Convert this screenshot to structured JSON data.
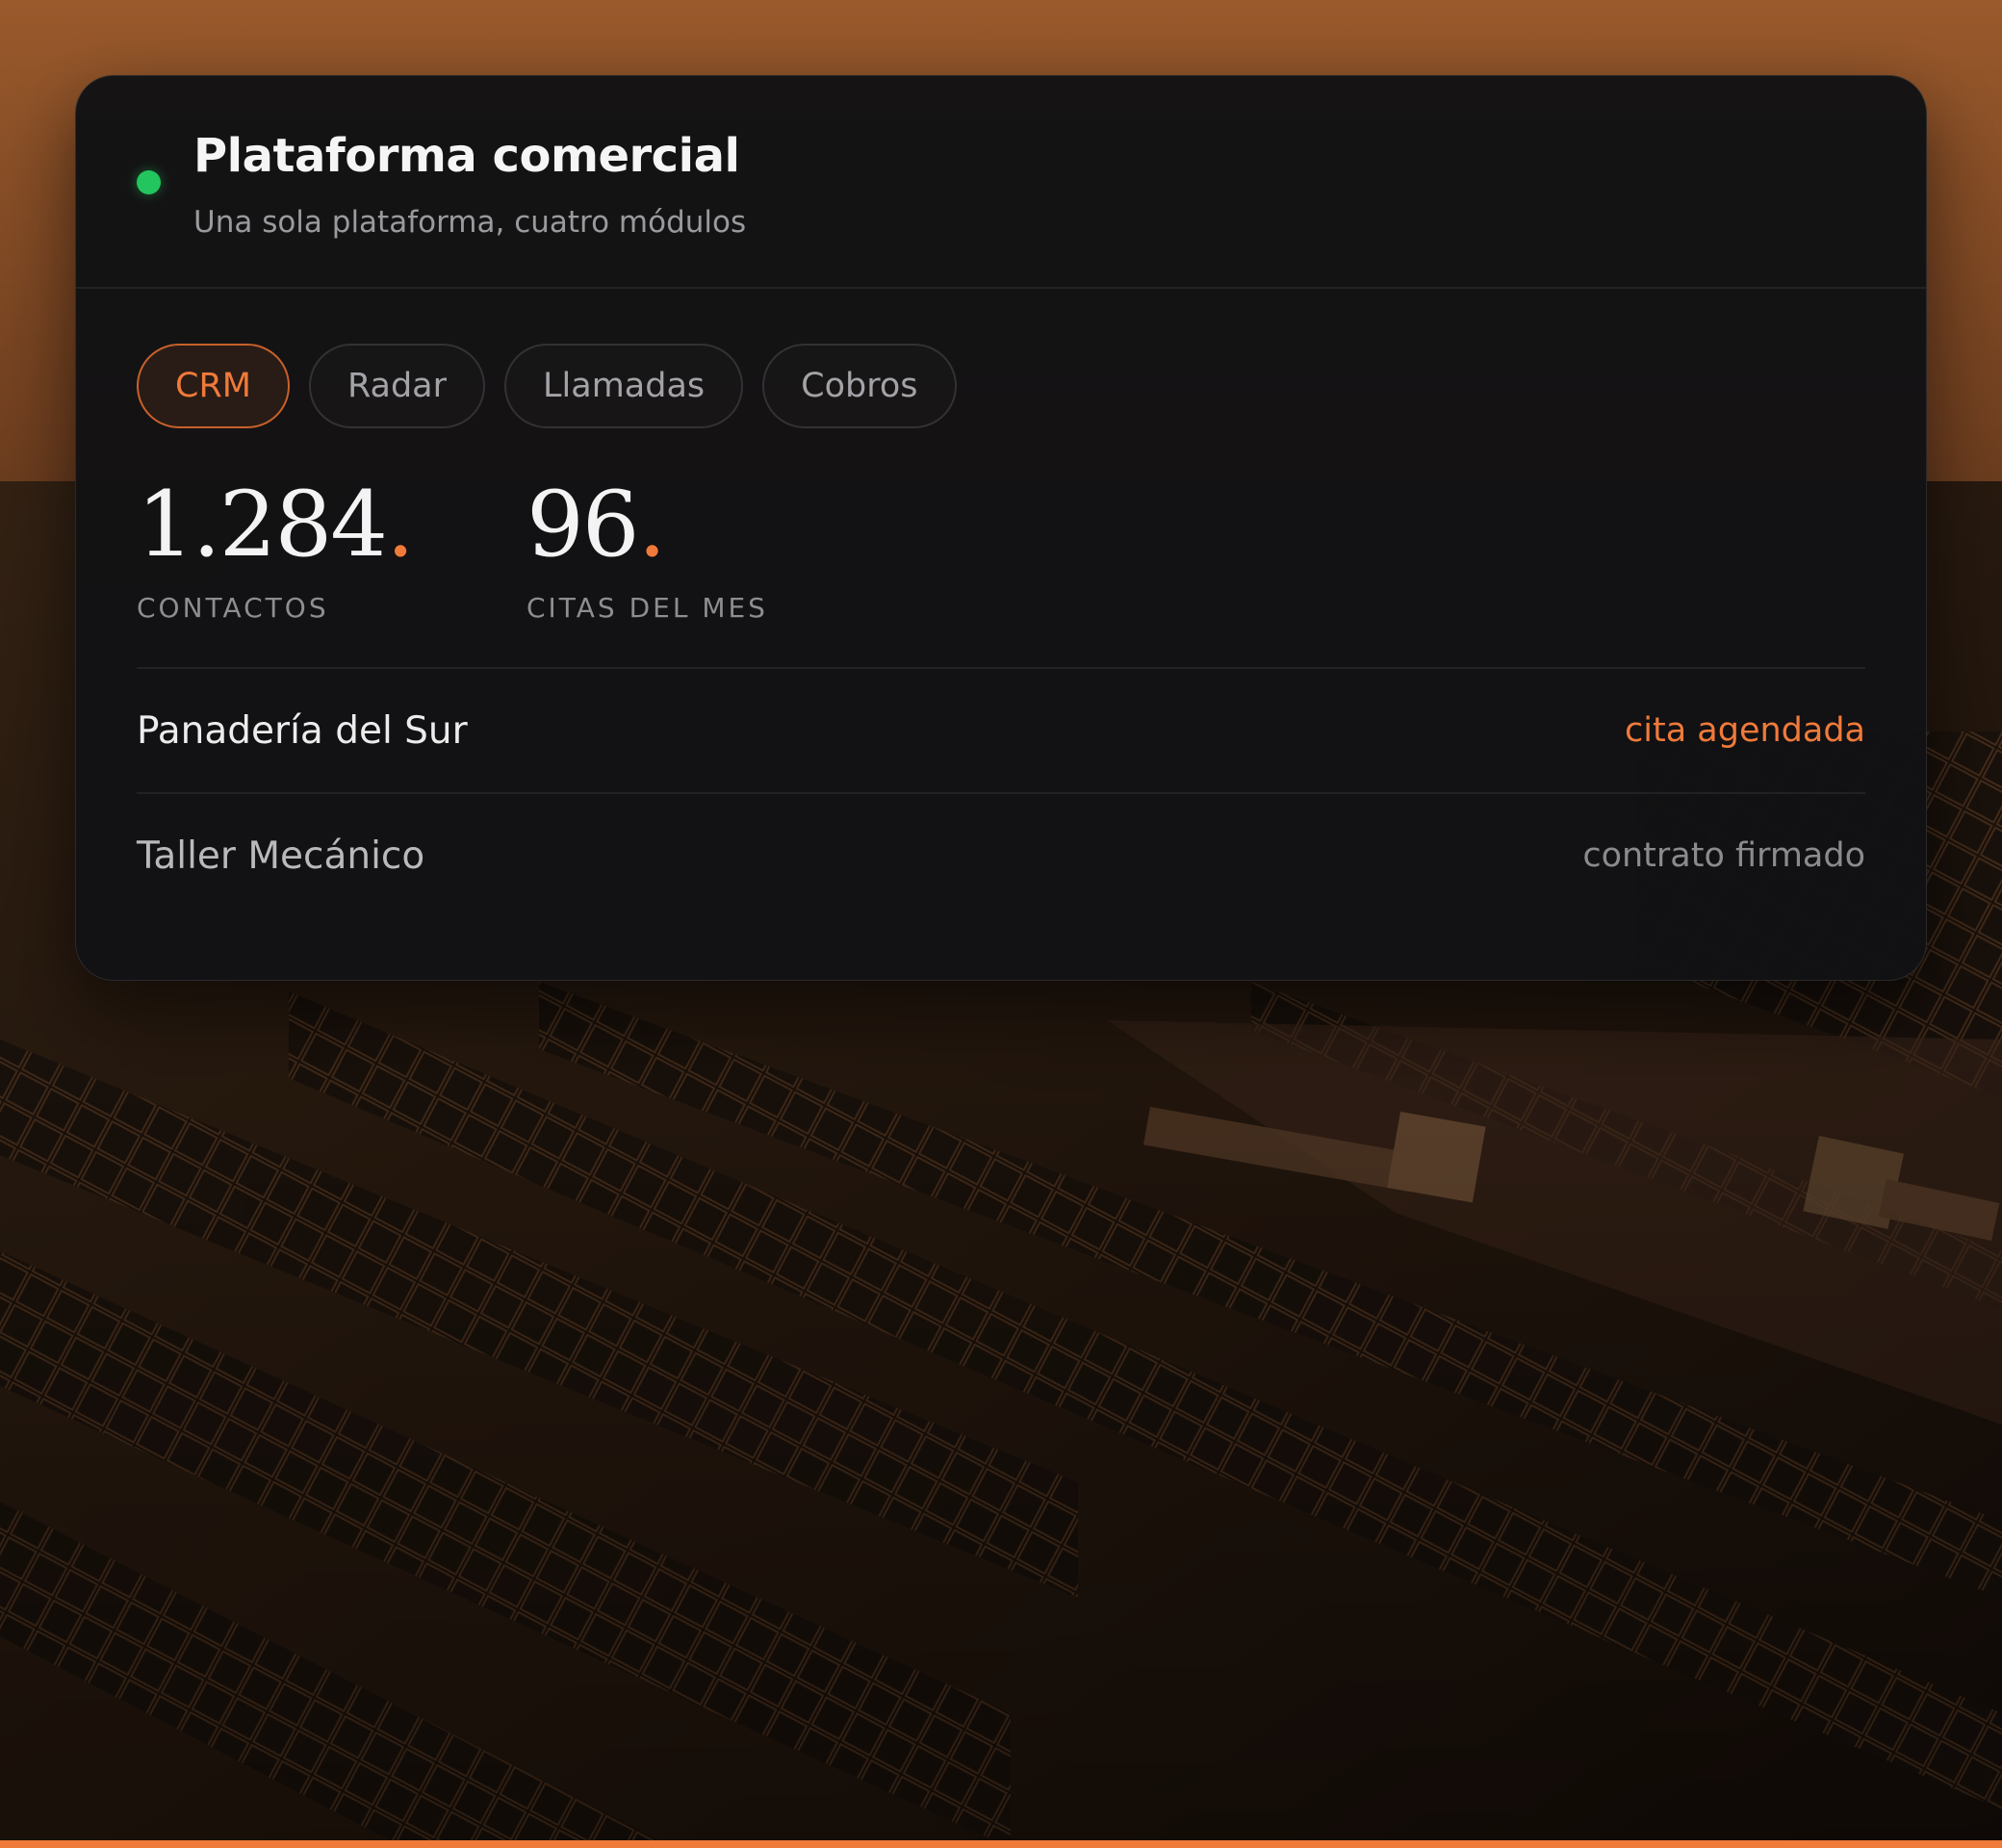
{
  "card": {
    "title": "Plataforma comercial",
    "subtitle": "Una sola plataforma, cuatro módulos",
    "status_color": "#22c55e"
  },
  "tabs": [
    {
      "label": "CRM",
      "active": true
    },
    {
      "label": "Radar",
      "active": false
    },
    {
      "label": "Llamadas",
      "active": false
    },
    {
      "label": "Cobros",
      "active": false
    }
  ],
  "stats": [
    {
      "value": "1.284",
      "suffix": ".",
      "label": "CONTACTOS"
    },
    {
      "value": "96",
      "suffix": ".",
      "label": "CITAS DEL MES"
    }
  ],
  "rows": [
    {
      "name": "Panadería del Sur",
      "status": "cita agendada"
    },
    {
      "name": "Taller Mecánico",
      "status": "contrato firmado"
    }
  ],
  "colors": {
    "accent": "#f07a3a",
    "card_bg": "#111113",
    "status_green": "#22c55e"
  },
  "icons": {
    "status": "status-dot-icon"
  }
}
